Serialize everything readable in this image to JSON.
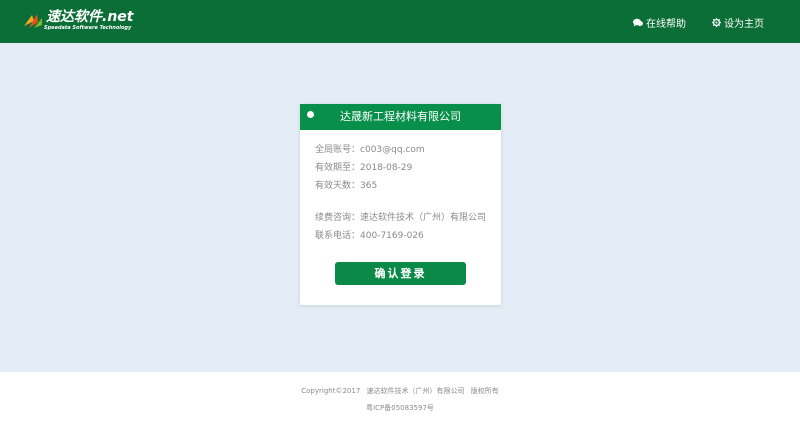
{
  "header": {
    "logo_title": "速达软件.net",
    "logo_subtitle": "Speedata Software Technology",
    "nav_help": "在线帮助",
    "nav_home": "设为主页"
  },
  "card": {
    "company": "达晟新工程材料有限公司",
    "account_label": "全局账号：",
    "account_value": "c003@qq.com",
    "expiry_label": "有效期至：",
    "expiry_value": "2018-08-29",
    "days_label": "有效天数：",
    "days_value": "365",
    "renew_label": "续费咨询：",
    "renew_value": "速达软件技术（广州）有限公司",
    "phone_label": "联系电话：",
    "phone_value": "400-7169-026",
    "login_button": "确认登录"
  },
  "footer": {
    "copyright": "Copyright©2017",
    "company": "速达软件技术（广州）有限公司",
    "rights": "版权所有",
    "icp": "粤ICP备05083597号"
  },
  "colors": {
    "header_bg": "#0a6e36",
    "card_head_bg": "#08904a",
    "button_bg": "#0a8a46",
    "page_bg": "#e4edf6"
  }
}
